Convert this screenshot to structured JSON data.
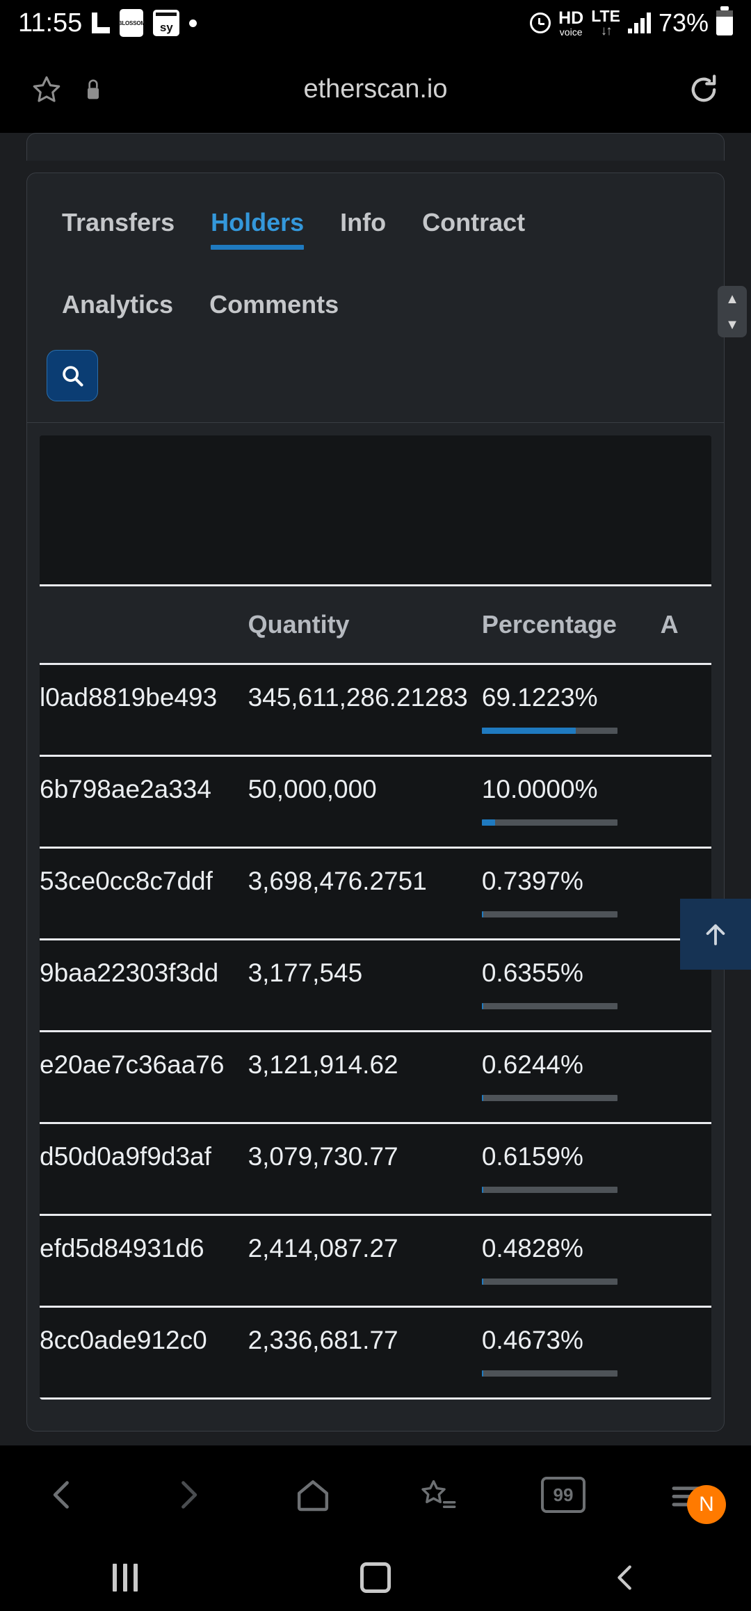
{
  "status_bar": {
    "time": "11:55",
    "left_icons": [
      "app-icon-l",
      "blossom-icon",
      "sy-icon",
      "dot-icon"
    ],
    "blossom_label": "BLOSSOM",
    "sy_label": "sy",
    "alarm_icon": "alarm-icon",
    "hd_top": "HD",
    "hd_bottom": "voice",
    "lte_top": "LTE",
    "lte_arrows": "↓↑",
    "signal_icon": "signal-bars-icon",
    "battery_text": "73%",
    "battery_icon": "battery-icon"
  },
  "browser": {
    "star_icon": "star-icon",
    "lock_icon": "lock-icon",
    "url": "etherscan.io",
    "reload_icon": "reload-icon",
    "bottom_nav": [
      {
        "name": "back",
        "icon": "chevron-left-icon",
        "label": ""
      },
      {
        "name": "forward",
        "icon": "chevron-right-icon",
        "label": ""
      },
      {
        "name": "home",
        "icon": "home-icon",
        "label": ""
      },
      {
        "name": "bookmarks",
        "icon": "bookmarks-star-icon",
        "label": ""
      },
      {
        "name": "tabs",
        "icon": "tab-count-icon",
        "label": "99"
      },
      {
        "name": "menu",
        "icon": "hamburger-menu-icon",
        "label": "N"
      }
    ],
    "tab_count": "99",
    "menu_badge": "N"
  },
  "android_nav": {
    "recents_icon": "recents-icon",
    "home_icon": "home-square-icon",
    "back_icon": "back-chevron-icon"
  },
  "content": {
    "tabs": [
      {
        "label": "Transfers",
        "active": false
      },
      {
        "label": "Holders",
        "active": true
      },
      {
        "label": "Info",
        "active": false
      },
      {
        "label": "Contract",
        "active": false
      },
      {
        "label": "Analytics",
        "active": false
      },
      {
        "label": "Comments",
        "active": false
      }
    ],
    "search_icon": "search-icon",
    "table": {
      "columns": [
        "",
        "Quantity",
        "Percentage",
        "A"
      ],
      "rows": [
        {
          "address": "l0ad8819be493",
          "quantity": "345,611,286.21283",
          "percentage": "69.1223%",
          "bar_pct": 69.1223
        },
        {
          "address": "6b798ae2a334",
          "quantity": "50,000,000",
          "percentage": "10.0000%",
          "bar_pct": 10.0
        },
        {
          "address": "53ce0cc8c7ddf",
          "quantity": "3,698,476.2751",
          "percentage": "0.7397%",
          "bar_pct": 0.7397
        },
        {
          "address": "9baa22303f3dd",
          "quantity": "3,177,545",
          "percentage": "0.6355%",
          "bar_pct": 0.6355
        },
        {
          "address": "e20ae7c36aa76",
          "quantity": "3,121,914.62",
          "percentage": "0.6244%",
          "bar_pct": 0.6244
        },
        {
          "address": "d50d0a9f9d3af",
          "quantity": "3,079,730.77",
          "percentage": "0.6159%",
          "bar_pct": 0.6159
        },
        {
          "address": "efd5d84931d6",
          "quantity": "2,414,087.27",
          "percentage": "0.4828%",
          "bar_pct": 0.4828
        },
        {
          "address": "8cc0ade912c0",
          "quantity": "2,336,681.77",
          "percentage": "0.4673%",
          "bar_pct": 0.4673
        }
      ]
    },
    "scroll_up_icon": "arrow-up-icon",
    "scrollbar_up_icon": "chevron-up-icon",
    "scrollbar_down_icon": "chevron-down-icon"
  },
  "colors": {
    "accent_blue": "#3498db",
    "link_blue": "#4da3e8",
    "bar_blue": "#1f7ac0",
    "badge_orange": "#ff7a00",
    "page_bg": "#1c1e21",
    "card_bg": "#212428",
    "row_bg": "#131517"
  }
}
